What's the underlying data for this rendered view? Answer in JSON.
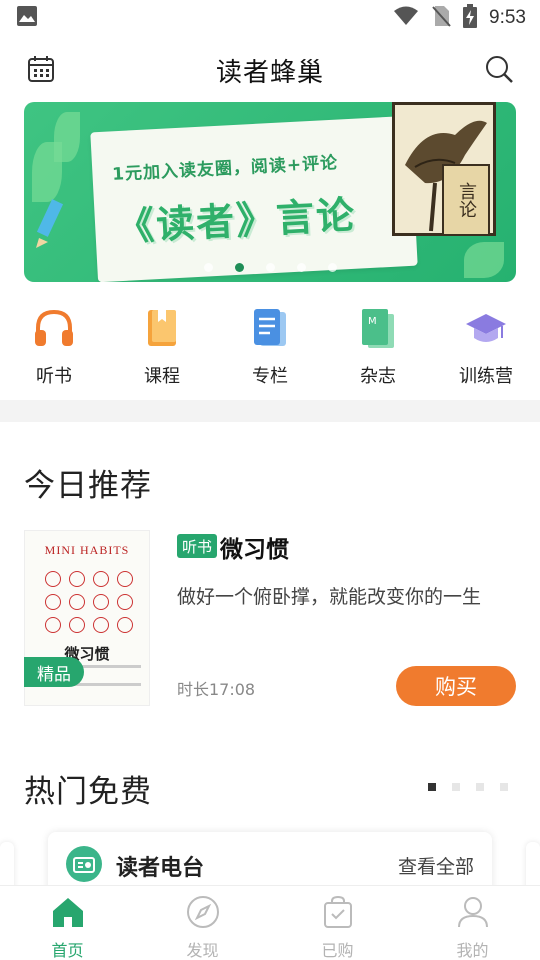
{
  "status_bar": {
    "time": "9:53"
  },
  "header": {
    "title": "读者蜂巢",
    "left_icon": "calendar-icon",
    "right_icon": "search-icon"
  },
  "banner": {
    "line1": "1元加入读友圈，阅读+评论",
    "line2": "《读者》言论",
    "stamp_text": "言论",
    "active_dot": 1,
    "dot_count": 5,
    "colors": {
      "bg": "#2fb873",
      "text": "#2fb06a"
    }
  },
  "categories": [
    {
      "label": "听书",
      "icon": "headphones-icon",
      "color": "#f07b2e"
    },
    {
      "label": "课程",
      "icon": "book-icon",
      "color": "#f5a33c"
    },
    {
      "label": "专栏",
      "icon": "document-icon",
      "color": "#4a90e2"
    },
    {
      "label": "杂志",
      "icon": "magazine-icon",
      "color": "#4bbf8a"
    },
    {
      "label": "训练营",
      "icon": "graduation-cap-icon",
      "color": "#8a7be0"
    }
  ],
  "today": {
    "section_title": "今日推荐",
    "book": {
      "cover_en": "MINI HABITS",
      "cover_cn": "微习惯",
      "badge": "精品",
      "tag": "听书",
      "title": "微习惯",
      "description": "做好一个俯卧撑，就能改变你的一生",
      "duration": "时长17:08",
      "buy_label": "购买"
    }
  },
  "hot": {
    "section_title": "热门免费",
    "pager_active": 0,
    "pager_count": 4,
    "card": {
      "name": "读者电台",
      "more_label": "查看全部",
      "icon": "radio-icon"
    }
  },
  "tabbar": [
    {
      "label": "首页",
      "icon": "home-icon",
      "active": true
    },
    {
      "label": "发现",
      "icon": "compass-icon",
      "active": false
    },
    {
      "label": "已购",
      "icon": "shopping-bag-icon",
      "active": false
    },
    {
      "label": "我的",
      "icon": "user-icon",
      "active": false
    }
  ],
  "colors": {
    "accent": "#27a66e",
    "buy": "#f07b2e"
  }
}
